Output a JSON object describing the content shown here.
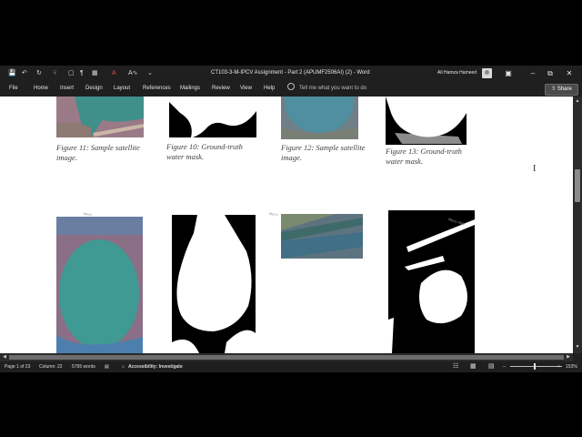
{
  "window": {
    "title": "CT103-3-M-IPCV Assignment - Part 2 (APUMF2506AI) (2)  -  Word",
    "user": "Ali Hamza Hameed"
  },
  "ribbon": {
    "tabs": [
      "File",
      "Home",
      "Insert",
      "Design",
      "Layout",
      "References",
      "Mailings",
      "Review",
      "View",
      "Help"
    ],
    "tell_me": "Tell me what you want to do",
    "share": "Share"
  },
  "document": {
    "captions": {
      "fig11": "Figure 11: Sample satellite image.",
      "fig10": "Figure 10: Ground-truth water mask.",
      "fig12": "Figure 12: Sample satellite image.",
      "fig13": "Figure 13: Ground-truth water mask."
    },
    "handles": {
      "a": "Menu",
      "b": "Menu",
      "c": "Menu Help"
    }
  },
  "statusbar": {
    "page": "Page 1 of 23",
    "column": "Column: 22",
    "words": "5795 words",
    "accessibility": "Accessibility: Investigate",
    "zoom": "153%"
  },
  "colors": {
    "titlebar": "#1f1f1f",
    "water": "#3f8f8a",
    "land": "#9a7a86"
  }
}
